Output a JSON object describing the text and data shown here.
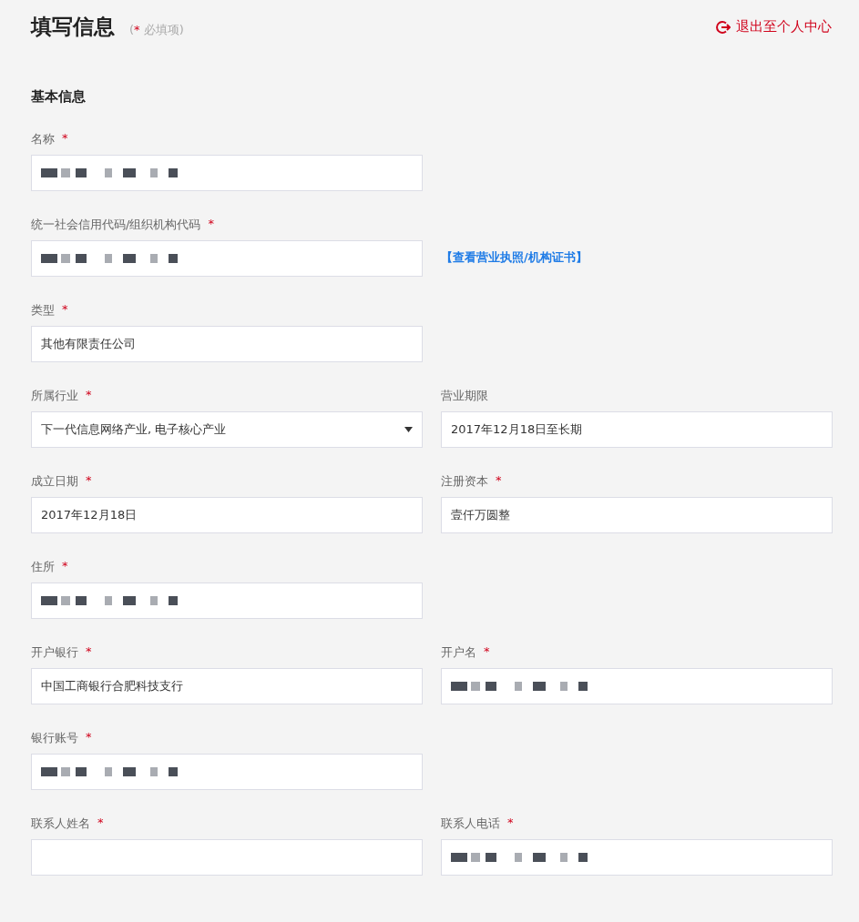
{
  "header": {
    "title": "填写信息",
    "note_open": "(",
    "note_mark": "*",
    "note_text": "必填项)",
    "logout_link": "退出至个人中心"
  },
  "section_title": "基本信息",
  "rows": [
    {
      "fields": [
        {
          "label": "名称",
          "required_mark": "*",
          "kind": "redacted"
        }
      ]
    },
    {
      "fields": [
        {
          "label": "统一社会信用代码/组织机构代码",
          "required_mark": "*",
          "kind": "redacted"
        }
      ],
      "link": "【查看营业执照/机构证书】"
    },
    {
      "fields": [
        {
          "label": "类型",
          "required_mark": "*",
          "kind": "text",
          "value": "其他有限责任公司"
        }
      ]
    },
    {
      "fields": [
        {
          "label": "所属行业",
          "required_mark": "*",
          "kind": "select",
          "value": "下一代信息网络产业, 电子核心产业"
        },
        {
          "label": "营业期限",
          "kind": "text",
          "value": "2017年12月18日至长期"
        }
      ]
    },
    {
      "fields": [
        {
          "label": "成立日期",
          "required_mark": "*",
          "kind": "text",
          "value": "2017年12月18日"
        },
        {
          "label": "注册资本",
          "required_mark": "*",
          "kind": "text",
          "value": "壹仟万圆整"
        }
      ]
    },
    {
      "fields": [
        {
          "label": "住所",
          "required_mark": "*",
          "kind": "redacted"
        }
      ]
    },
    {
      "fields": [
        {
          "label": "开户银行",
          "required_mark": "*",
          "kind": "text",
          "value": "中国工商银行合肥科技支行"
        },
        {
          "label": "开户名",
          "required_mark": "*",
          "kind": "redacted"
        }
      ]
    },
    {
      "fields": [
        {
          "label": "银行账号",
          "required_mark": "*",
          "kind": "redacted"
        }
      ]
    },
    {
      "fields": [
        {
          "label": "联系人姓名",
          "required_mark": "*",
          "kind": "text"
        },
        {
          "label": "联系人电话",
          "required_mark": "*",
          "kind": "redacted"
        }
      ]
    }
  ]
}
